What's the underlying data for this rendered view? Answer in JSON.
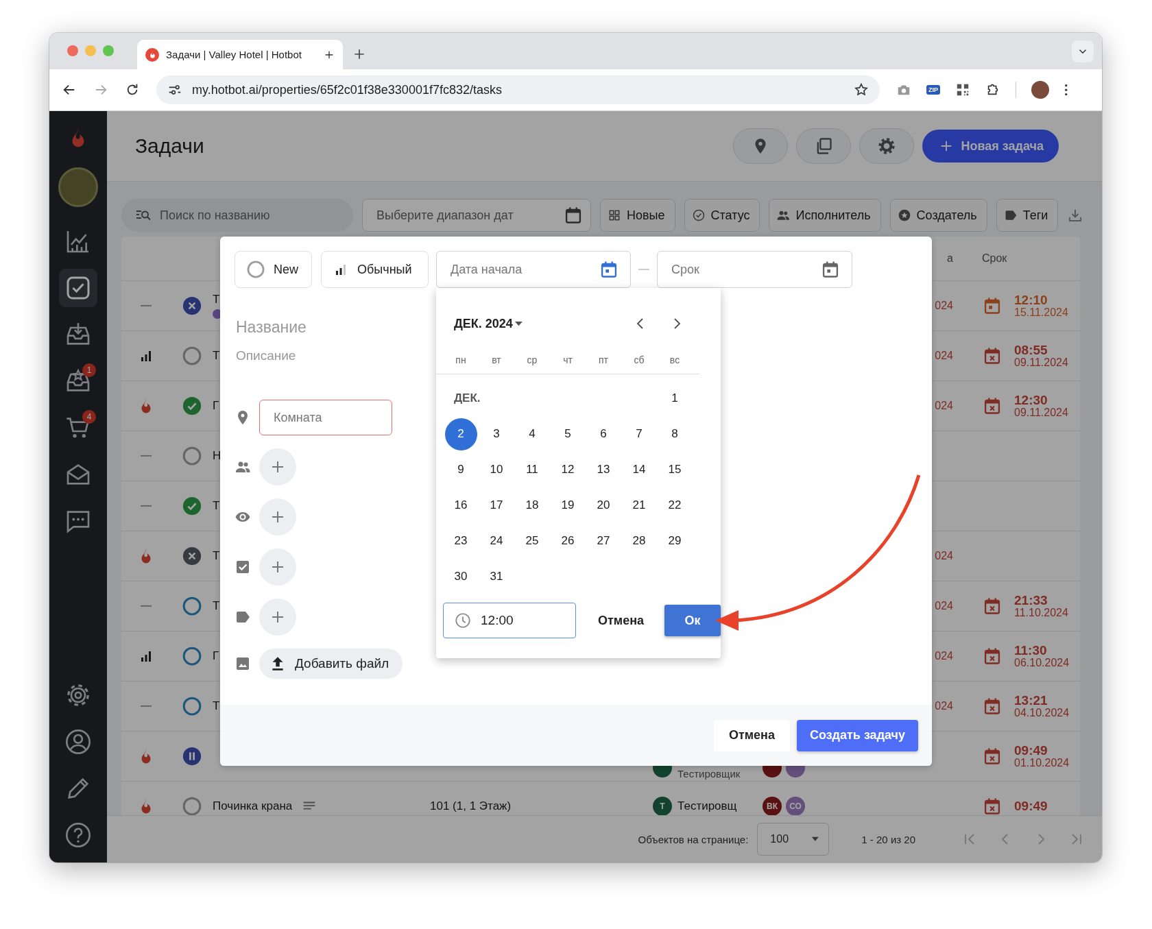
{
  "browser": {
    "tab_title": "Задачи | Valley Hotel | Hotbot",
    "url": "my.hotbot.ai/properties/65f2c01f38e330001f7fc832/tasks",
    "extensions": [
      {
        "kind": "camera"
      },
      {
        "kind": "zip",
        "label": "ZIP"
      },
      {
        "kind": "qr"
      },
      {
        "kind": "puzzle"
      }
    ]
  },
  "sidebar": {
    "items": [
      {
        "kind": "chart",
        "selected": false
      },
      {
        "kind": "tasks",
        "selected": true
      },
      {
        "kind": "inbox",
        "selected": false
      },
      {
        "kind": "star_inbox",
        "selected": false,
        "badge": "1"
      },
      {
        "kind": "cart",
        "selected": false,
        "badge": "4"
      },
      {
        "kind": "mail",
        "selected": false
      },
      {
        "kind": "chat",
        "selected": false
      }
    ],
    "bottom_items": [
      {
        "kind": "settings",
        "selected": false
      },
      {
        "kind": "profile",
        "selected": false
      },
      {
        "kind": "pencil",
        "selected": false
      },
      {
        "kind": "help",
        "selected": false
      }
    ]
  },
  "header": {
    "title": "Задачи",
    "new_task_button": "Новая задача"
  },
  "filters": {
    "search_placeholder": "Поиск по названию",
    "date_placeholder": "Выберите диапазон дат",
    "chips": [
      {
        "kind": "grid",
        "label": "Новые"
      },
      {
        "kind": "check",
        "label": "Статус"
      },
      {
        "kind": "people",
        "label": "Исполнитель"
      },
      {
        "kind": "star",
        "label": "Создатель"
      },
      {
        "kind": "tag",
        "label": "Теги"
      }
    ]
  },
  "table": {
    "columns": [
      "а",
      "Срок"
    ],
    "rows": [
      {
        "priority": {
          "kind": "none"
        },
        "status": {
          "kind": "declined"
        },
        "title": "Т",
        "marker": {
          "color": "#5b4581"
        },
        "date_fragment": "024",
        "due": {
          "kind": "upcoming",
          "time": "12:10",
          "date": "15.11.2024"
        }
      },
      {
        "priority": {
          "kind": "medium"
        },
        "status": {
          "kind": "new"
        },
        "title": "Т",
        "date_fragment": "024",
        "due": {
          "kind": "overdue",
          "time": "08:55",
          "date": "09.11.2024"
        }
      },
      {
        "priority": {
          "kind": "high"
        },
        "status": {
          "kind": "done"
        },
        "title": "Г",
        "date_fragment": "024",
        "due": {
          "kind": "overdue",
          "time": "12:30",
          "date": "09.11.2024"
        }
      },
      {
        "priority": {
          "kind": "none"
        },
        "status": {
          "kind": "new"
        },
        "title": "Н"
      },
      {
        "priority": {
          "kind": "none"
        },
        "status": {
          "kind": "done"
        },
        "title": "Т"
      },
      {
        "priority": {
          "kind": "high"
        },
        "status": {
          "kind": "cancelled"
        },
        "title": "Т",
        "date_fragment": "024"
      },
      {
        "priority": {
          "kind": "none"
        },
        "status": {
          "kind": "in_progress"
        },
        "title": "Т",
        "date_fragment": "024",
        "due": {
          "kind": "overdue",
          "time": "21:33",
          "date": "11.10.2024"
        }
      },
      {
        "priority": {
          "kind": "medium"
        },
        "status": {
          "kind": "in_progress"
        },
        "title": "Г",
        "date_fragment": "024",
        "due": {
          "kind": "overdue",
          "time": "11:30",
          "date": "06.10.2024"
        }
      },
      {
        "priority": {
          "kind": "none"
        },
        "status": {
          "kind": "in_progress"
        },
        "title": "Т",
        "date_fragment": "024",
        "due": {
          "kind": "overdue",
          "time": "13:21",
          "date": "04.10.2024"
        }
      },
      {
        "priority": {
          "kind": "high"
        },
        "status": {
          "kind": "paused"
        },
        "executor": {
          "color": "#13442f",
          "role": "Тестировщик"
        },
        "avatars": [
          {
            "color": "#591111"
          },
          {
            "color": "#634f7d"
          }
        ],
        "due": {
          "kind": "overdue",
          "time": "09:49",
          "date": "01.10.2024"
        }
      },
      {
        "priority": {
          "kind": "high"
        },
        "status": {
          "kind": "new"
        },
        "title": "Починка крана",
        "has_description": true,
        "room": "101 (1, 1 Этаж)",
        "executor": {
          "color": "#13442f",
          "initial": "Т",
          "name": "Тестировщ"
        },
        "avatars": [
          {
            "color": "#591111",
            "initials": "ВК"
          },
          {
            "color": "#634f7d",
            "initials": "СО"
          }
        ],
        "due": {
          "kind": "overdue",
          "time": "09:49"
        }
      }
    ]
  },
  "pagination": {
    "label": "Объектов на странице:",
    "page_size": "100",
    "range": "1 - 20 из 20",
    "nav": [
      {
        "kind": "first",
        "disabled": true
      },
      {
        "kind": "prev",
        "disabled": true
      },
      {
        "kind": "next",
        "disabled": true
      },
      {
        "kind": "last",
        "disabled": true
      }
    ]
  },
  "dialog": {
    "status_chip": "New",
    "priority_chip": "Обычный",
    "start_field": {
      "placeholder": "Дата начала",
      "active": true
    },
    "due_field": {
      "placeholder": "Срок",
      "active": false
    },
    "title_placeholder": "Название",
    "description_placeholder": "Описание",
    "room_field": {
      "placeholder": "Комната",
      "invalid": true
    },
    "assign_rows": [
      {
        "kind": "people"
      },
      {
        "kind": "eye"
      },
      {
        "kind": "checkbox"
      },
      {
        "kind": "tag"
      }
    ],
    "file_row": {
      "kind": "image",
      "button": "Добавить файл"
    },
    "cancel_button": "Отмена",
    "create_button": "Создать задачу",
    "calendar": {
      "month_label": "ДЕК. 2024",
      "weekdays": [
        "пн",
        "вт",
        "ср",
        "чт",
        "пт",
        "сб",
        "вс"
      ],
      "short_month": "ДЕК.",
      "time_value": "12:00",
      "cancel_button": "Отмена",
      "ok_button": "Ок",
      "weeks": [
        [
          {
            "label": "1",
            "selected": false
          }
        ],
        [
          {
            "label": "2",
            "selected": true
          },
          {
            "label": "3",
            "selected": false
          },
          {
            "label": "4",
            "selected": false
          },
          {
            "label": "5",
            "selected": false
          },
          {
            "label": "6",
            "selected": false
          },
          {
            "label": "7",
            "selected": false
          },
          {
            "label": "8",
            "selected": false
          }
        ],
        [
          {
            "label": "9",
            "selected": false
          },
          {
            "label": "10",
            "selected": false
          },
          {
            "label": "11",
            "selected": false
          },
          {
            "label": "12",
            "selected": false
          },
          {
            "label": "13",
            "selected": false
          },
          {
            "label": "14",
            "selected": false
          },
          {
            "label": "15",
            "selected": false
          }
        ],
        [
          {
            "label": "16",
            "selected": false
          },
          {
            "label": "17",
            "selected": false
          },
          {
            "label": "18",
            "selected": false
          },
          {
            "label": "19",
            "selected": false
          },
          {
            "label": "20",
            "selected": false
          },
          {
            "label": "21",
            "selected": false
          },
          {
            "label": "22",
            "selected": false
          }
        ],
        [
          {
            "label": "23",
            "selected": false
          },
          {
            "label": "24",
            "selected": false
          },
          {
            "label": "25",
            "selected": false
          },
          {
            "label": "26",
            "selected": false
          },
          {
            "label": "27",
            "selected": false
          },
          {
            "label": "28",
            "selected": false
          },
          {
            "label": "29",
            "selected": false
          }
        ],
        [
          {
            "label": "30",
            "selected": false
          },
          {
            "label": "31",
            "selected": false
          }
        ]
      ]
    }
  },
  "annotation": {
    "kind": "arrow"
  }
}
